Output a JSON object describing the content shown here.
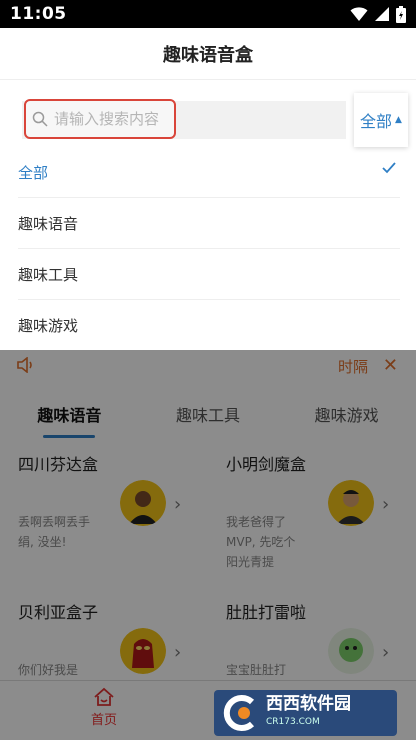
{
  "status_bar": {
    "time": "11:05"
  },
  "header": {
    "title": "趣味语音盒"
  },
  "search": {
    "placeholder": "请输入搜索内容",
    "value": ""
  },
  "category_dropdown": {
    "selected": "全部",
    "accent_color": "#2f7fc5"
  },
  "category_options": [
    {
      "label": "全部",
      "selected": true
    },
    {
      "label": "趣味语音",
      "selected": false
    },
    {
      "label": "趣味工具",
      "selected": false
    },
    {
      "label": "趣味游戏",
      "selected": false
    }
  ],
  "notice": {
    "text": "时隔",
    "color": "#e0702c"
  },
  "tabs": [
    {
      "label": "趣味语音",
      "active": true
    },
    {
      "label": "趣味工具",
      "active": false
    },
    {
      "label": "趣味游戏",
      "active": false
    }
  ],
  "cards": [
    {
      "title": "四川芬达盒",
      "desc": "丢啊丢啊丢手绢, 没坐!",
      "avatar": "avatar-man-yellow"
    },
    {
      "title": "小明剑魔盒",
      "desc": "我老爸得了MVP, 先吃个阳光青提",
      "avatar": "avatar-man-yellow"
    },
    {
      "title": "贝利亚盒子",
      "desc": "你们好我是",
      "avatar": "avatar-ultraman-red"
    },
    {
      "title": "肚肚打雷啦",
      "desc": "宝宝肚肚打",
      "avatar": "avatar-green-cartoon"
    }
  ],
  "bottom_nav": {
    "home_label": "首页",
    "home_color": "#e33333"
  },
  "watermark": {
    "brand": "西西软件园",
    "site": "CR173.COM"
  }
}
